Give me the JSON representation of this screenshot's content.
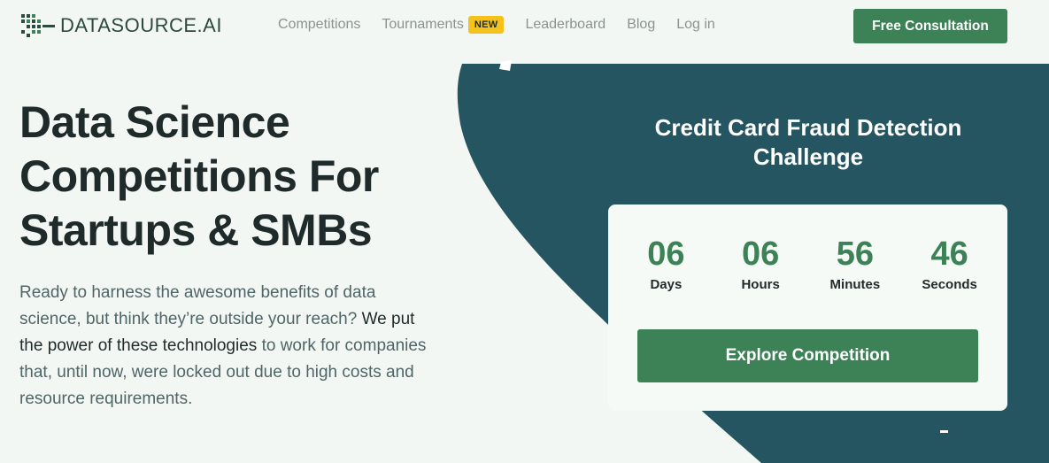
{
  "header": {
    "logo_text": "DATASOURCE.AI",
    "nav": [
      {
        "label": "Competitions"
      },
      {
        "label": "Tournaments",
        "badge": "NEW"
      },
      {
        "label": "Leaderboard"
      },
      {
        "label": "Blog"
      },
      {
        "label": "Log in"
      }
    ],
    "cta_label": "Free Consultation"
  },
  "hero": {
    "title": "Data Science Competitions For Startups & SMBs",
    "text_part1": "Ready to harness the awesome benefits of data science, but think they’re outside your reach? ",
    "text_emphasis": "We put the power of these technologies",
    "text_part2": " to work for companies that, until now, were locked out due to high costs and resource requirements."
  },
  "challenge": {
    "title": "Credit Card Fraud Detection Challenge",
    "countdown": [
      {
        "value": "06",
        "label": "Days"
      },
      {
        "value": "06",
        "label": "Hours"
      },
      {
        "value": "56",
        "label": "Minutes"
      },
      {
        "value": "46",
        "label": "Seconds"
      }
    ],
    "button_label": "Explore Competition"
  },
  "colors": {
    "accent_green": "#3d8157",
    "teal_panel": "#245561",
    "badge_yellow": "#f4c21b",
    "background": "#f3f7f4"
  }
}
